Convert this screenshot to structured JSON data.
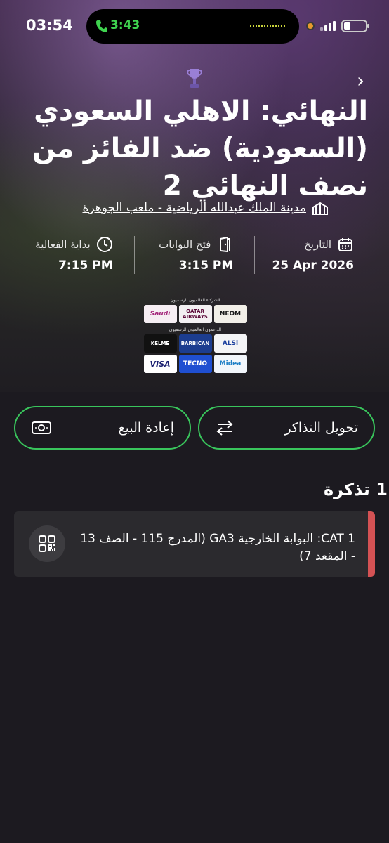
{
  "status_bar": {
    "time": "03:54",
    "call_time": "3:43"
  },
  "event": {
    "title": "النهائي: الاهلي السعودي (السعودية) ضد الفائز من نصف النهائي 2",
    "venue": "مدينة الملك عبدالله الرياضية - ملعب الجوهرة"
  },
  "info": [
    {
      "label": "التاريخ",
      "value": "25 Apr 2026",
      "icon": "calendar-icon"
    },
    {
      "label": "فتح البوابات",
      "value": "3:15 PM",
      "icon": "door-icon"
    },
    {
      "label": "بداية الفعالية",
      "value": "7:15 PM",
      "icon": "clock-icon"
    }
  ],
  "sponsors": {
    "caption_1": "الشركاء العالميون الرسميون",
    "row_1": [
      "NEOM",
      "QATAR AIRWAYS",
      "Saudi"
    ],
    "caption_2": "الداعمون العالميون الرسميون",
    "row_2": [
      "ALSi",
      "BARBICAN",
      "KELME"
    ],
    "row_3": [
      "Midea",
      "TECNO",
      "VISA"
    ]
  },
  "actions": {
    "transfer_label": "تحويل التذاكر",
    "resell_label": "إعادة البيع"
  },
  "tickets": {
    "title": "1 تذكرة",
    "items": [
      {
        "text": "CAT 1: البوابة الخارجية GA3 (المدرج 115 - الصف 13 - المقعد 7)"
      }
    ]
  },
  "colors": {
    "accent_green": "#39c55c",
    "ticket_accent": "#d45254",
    "background": "#1c1a20"
  }
}
